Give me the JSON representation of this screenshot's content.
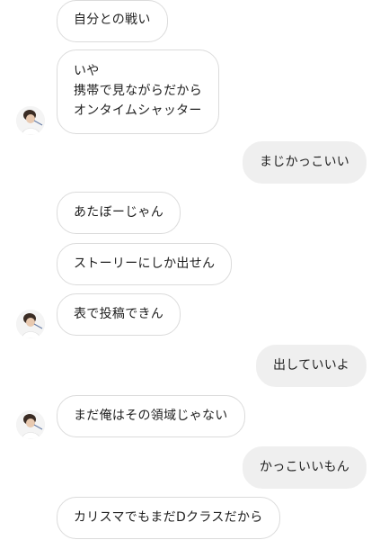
{
  "messages": [
    {
      "id": "m1",
      "side": "in",
      "lines": [
        "自分との戦い"
      ]
    },
    {
      "id": "m2",
      "side": "in",
      "lines": [
        "いや",
        "携帯で見ながらだから",
        "オンタイムシャッター"
      ]
    },
    {
      "id": "m3",
      "side": "out",
      "lines": [
        "まじかっこいい"
      ]
    },
    {
      "id": "m4",
      "side": "in",
      "lines": [
        "あたぼーじゃん"
      ]
    },
    {
      "id": "m5",
      "side": "in",
      "lines": [
        "ストーリーにしか出せん"
      ]
    },
    {
      "id": "m6",
      "side": "in",
      "lines": [
        "表で投稿できん"
      ]
    },
    {
      "id": "m7",
      "side": "out",
      "lines": [
        "出していいよ"
      ]
    },
    {
      "id": "m8",
      "side": "in",
      "lines": [
        "まだ俺はその領域じゃない"
      ]
    },
    {
      "id": "m9",
      "side": "out",
      "lines": [
        "かっこいいもん"
      ]
    },
    {
      "id": "m10",
      "side": "in",
      "lines": [
        "カリスマでもまだDクラスだから"
      ]
    }
  ],
  "avatar": {
    "icon": "profile-avatar-icon"
  }
}
